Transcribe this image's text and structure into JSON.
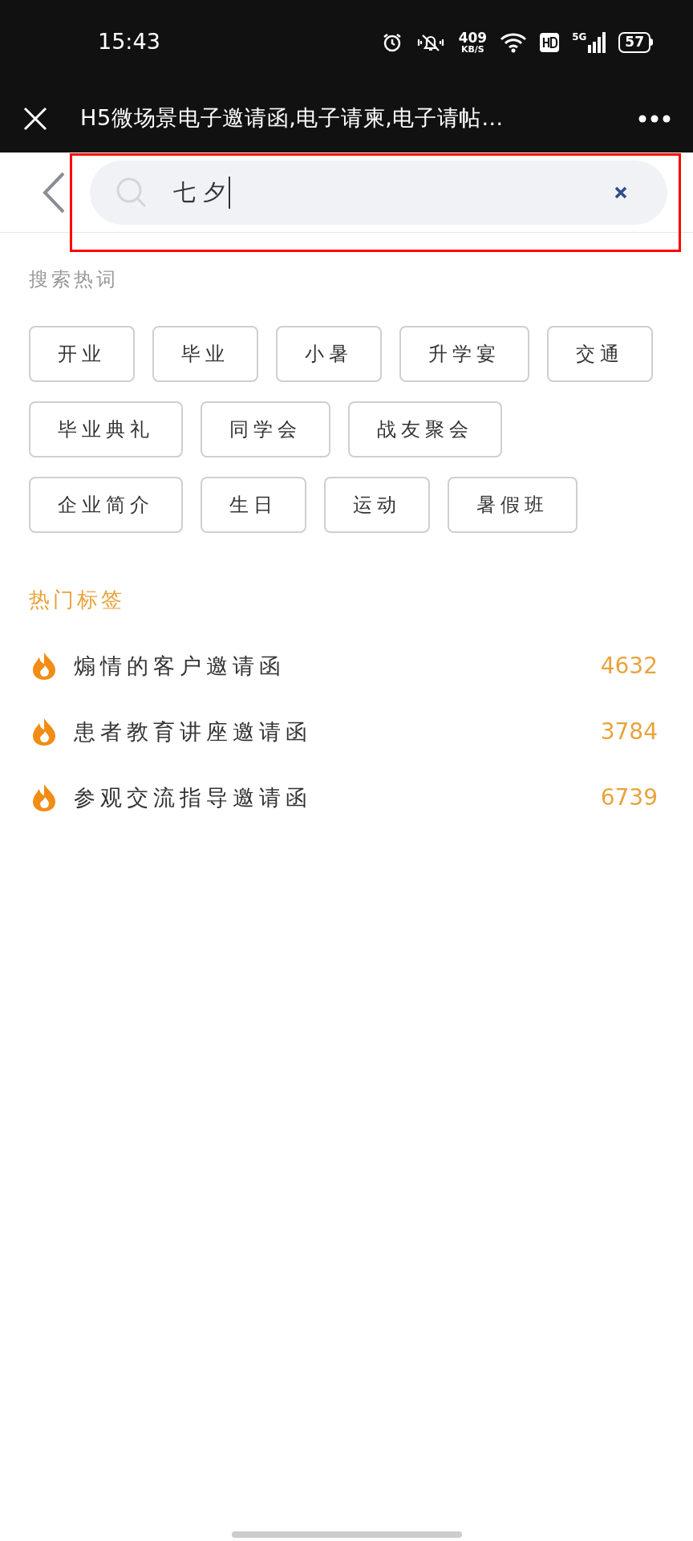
{
  "status_bar": {
    "time": "15:43",
    "speed_value": "409",
    "speed_unit": "KB/S",
    "network": "5G",
    "battery": "57"
  },
  "title_bar": {
    "title": "H5微场景电子邀请函,电子请柬,电子请帖…"
  },
  "search": {
    "value": "七 夕"
  },
  "hot_words": {
    "title": "搜索热词",
    "rows": [
      [
        "开业",
        "毕业",
        "小暑",
        "升学宴",
        "交通"
      ],
      [
        "毕业典礼",
        "同学会",
        "战友聚会"
      ],
      [
        "企业简介",
        "生日",
        "运动",
        "暑假班"
      ]
    ]
  },
  "hot_tags": {
    "title": "热门标签",
    "items": [
      {
        "label": "煽情的客户邀请函",
        "count": "4632"
      },
      {
        "label": "患者教育讲座邀请函",
        "count": "3784"
      },
      {
        "label": "参观交流指导邀请函",
        "count": "6739"
      }
    ]
  }
}
